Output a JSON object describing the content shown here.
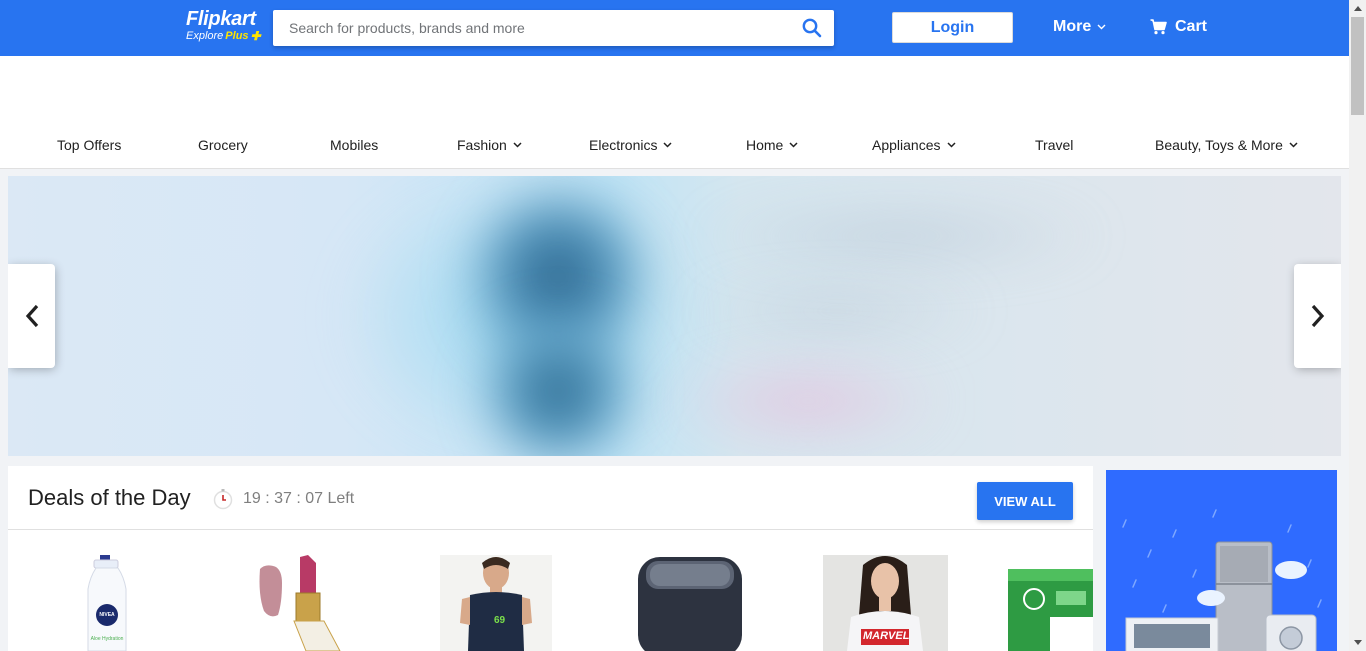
{
  "header": {
    "logo_main": "Flipkart",
    "logo_sub": "Explore",
    "logo_plus": "Plus",
    "search_placeholder": "Search for products, brands and more",
    "login_label": "Login",
    "more_label": "More",
    "cart_label": "Cart",
    "brand_color": "#2874f0",
    "accent_color": "#ffe500"
  },
  "nav": {
    "items": [
      {
        "label": "Top Offers",
        "has_dropdown": false
      },
      {
        "label": "Grocery",
        "has_dropdown": false
      },
      {
        "label": "Mobiles",
        "has_dropdown": false
      },
      {
        "label": "Fashion",
        "has_dropdown": true
      },
      {
        "label": "Electronics",
        "has_dropdown": true
      },
      {
        "label": "Home",
        "has_dropdown": true
      },
      {
        "label": "Appliances",
        "has_dropdown": true
      },
      {
        "label": "Travel",
        "has_dropdown": false
      },
      {
        "label": "Beauty, Toys & More",
        "has_dropdown": true
      }
    ]
  },
  "banner": {
    "prev_icon": "chevron-left-icon",
    "next_icon": "chevron-right-icon"
  },
  "deals": {
    "title": "Deals of the Day",
    "timer_text": "19 : 37 : 07 Left",
    "view_all_label": "VIEW ALL",
    "products": [
      {
        "name": "lotion-bottle",
        "label_text": "NIVEA",
        "sub_text": "Aloe Hydration"
      },
      {
        "name": "lipstick"
      },
      {
        "name": "sleeveless-tshirt",
        "print_text": "69"
      },
      {
        "name": "bluetooth-speaker"
      },
      {
        "name": "graphic-tshirt",
        "print_text": "MARVEL"
      },
      {
        "name": "sanitary-pads"
      }
    ]
  }
}
